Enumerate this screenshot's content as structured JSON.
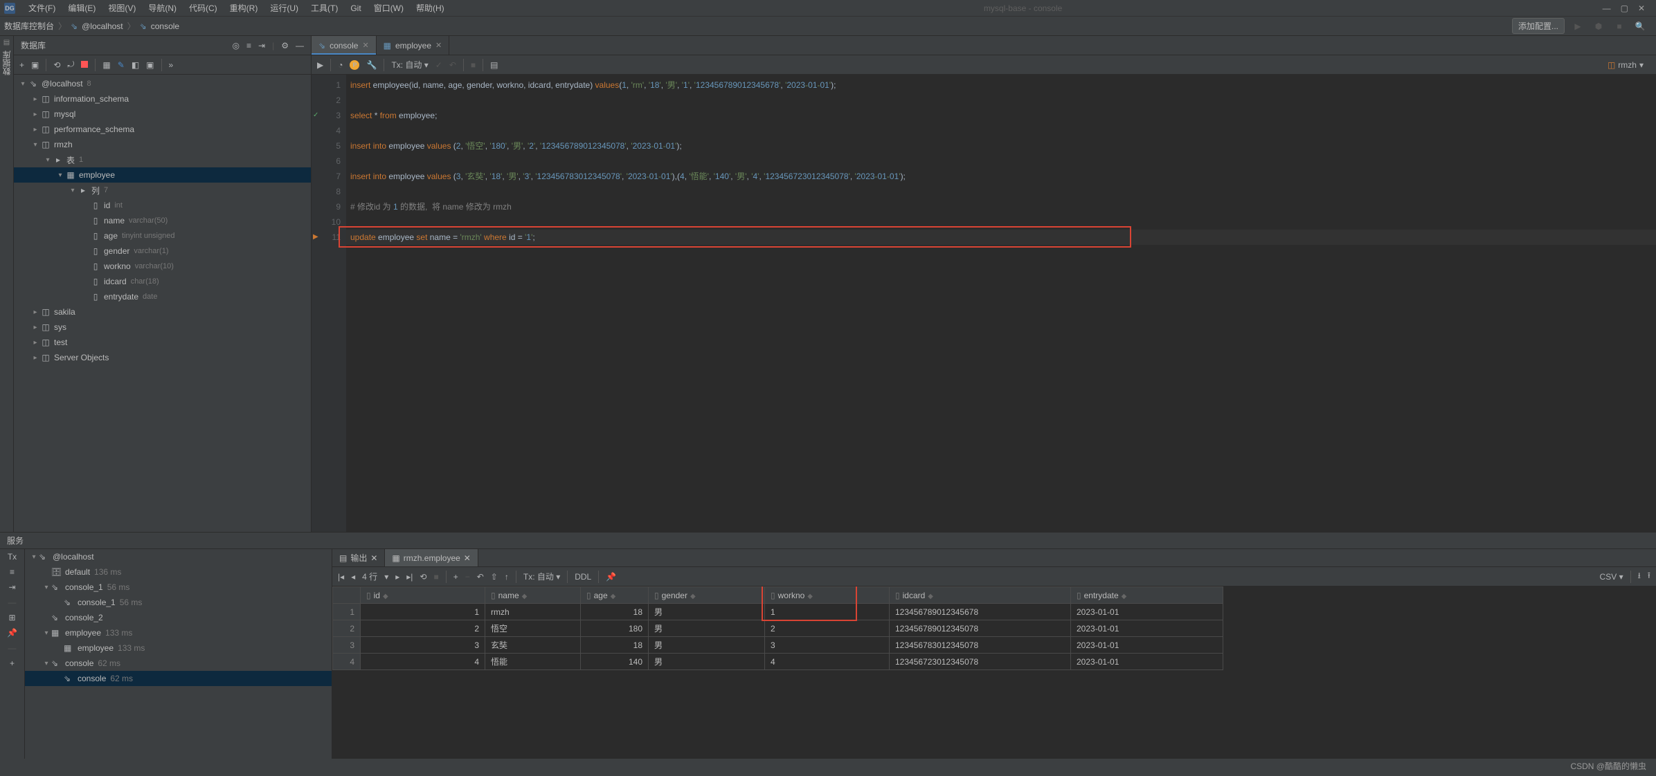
{
  "window": {
    "title": "mysql-base - console"
  },
  "menu": [
    "文件(F)",
    "编辑(E)",
    "视图(V)",
    "导航(N)",
    "代码(C)",
    "重构(R)",
    "运行(U)",
    "工具(T)",
    "Git",
    "窗口(W)",
    "帮助(H)"
  ],
  "breadcrumb": [
    "数据库控制台",
    "@localhost",
    "console"
  ],
  "nav_add_config": "添加配置...",
  "side_tab": "数据库",
  "db_panel_title": "数据库",
  "db_tree": {
    "root": {
      "label": "@localhost",
      "badge": "8"
    },
    "schemas": [
      {
        "label": "information_schema"
      },
      {
        "label": "mysql"
      },
      {
        "label": "performance_schema"
      },
      {
        "label": "rmzh",
        "expanded": true,
        "tables_label": "表",
        "tables_badge": "1",
        "table": {
          "label": "employee",
          "cols_label": "列",
          "cols_badge": "7",
          "columns": [
            {
              "name": "id",
              "type": "int"
            },
            {
              "name": "name",
              "type": "varchar(50)"
            },
            {
              "name": "age",
              "type": "tinyint unsigned"
            },
            {
              "name": "gender",
              "type": "varchar(1)"
            },
            {
              "name": "workno",
              "type": "varchar(10)"
            },
            {
              "name": "idcard",
              "type": "char(18)"
            },
            {
              "name": "entrydate",
              "type": "date"
            }
          ]
        }
      },
      {
        "label": "sakila"
      },
      {
        "label": "sys"
      },
      {
        "label": "test"
      },
      {
        "label": "Server Objects"
      }
    ]
  },
  "editor_tabs": [
    {
      "label": "console",
      "active": true,
      "icon": "console"
    },
    {
      "label": "employee",
      "active": false,
      "icon": "table"
    }
  ],
  "tx_label": "Tx: 自动",
  "schema_indicator": "rmzh",
  "code_lines": [
    "insert employee(id, name, age, gender, workno, idcard, entrydate) values(1, 'rm', '18', '男', '1', '123456789012345678', '2023-01-01');",
    "",
    "select * from employee;",
    "",
    "insert into employee values (2, '悟空', '180', '男', '2', '123456789012345078', '2023-01-01');",
    "",
    "insert into employee values (3, '玄奘', '18', '男', '3', '123456783012345078', '2023-01-01'),(4, '悟能', '140', '男', '4', '123456723012345078', '2023-01-01');",
    "",
    "# 修改id 为 1 的数据,  将 name 修改为 rmzh",
    "",
    "update employee set name = 'rmzh' where id = '1';"
  ],
  "services_title": "服务",
  "svc_tree": {
    "root": "@localhost",
    "items": [
      {
        "label": "default",
        "meta": "136 ms",
        "icon": "db"
      },
      {
        "label": "console_1",
        "meta": "56 ms",
        "icon": "console",
        "expanded": true,
        "children": [
          {
            "label": "console_1",
            "meta": "56 ms",
            "icon": "console"
          }
        ]
      },
      {
        "label": "console_2",
        "icon": "console"
      },
      {
        "label": "employee",
        "meta": "133 ms",
        "icon": "table",
        "expanded": true,
        "children": [
          {
            "label": "employee",
            "meta": "133 ms",
            "icon": "table"
          }
        ]
      },
      {
        "label": "console",
        "meta": "62 ms",
        "icon": "console",
        "expanded": true,
        "selected": true,
        "children": [
          {
            "label": "console",
            "meta": "62 ms",
            "icon": "console",
            "selected": true
          }
        ]
      }
    ]
  },
  "result_tabs": [
    {
      "label": "输出",
      "icon": "output"
    },
    {
      "label": "rmzh.employee",
      "icon": "table",
      "active": true
    }
  ],
  "result_toolbar": {
    "rows_label": "4 行",
    "tx": "Tx: 自动",
    "ddl": "DDL",
    "csv": "CSV"
  },
  "grid": {
    "columns": [
      "id",
      "name",
      "age",
      "gender",
      "workno",
      "idcard",
      "entrydate"
    ],
    "rows": [
      {
        "n": 1,
        "id": 1,
        "name": "rmzh",
        "age": 18,
        "gender": "男",
        "workno": "1",
        "idcard": "123456789012345678",
        "entrydate": "2023-01-01"
      },
      {
        "n": 2,
        "id": 2,
        "name": "悟空",
        "age": 180,
        "gender": "男",
        "workno": "2",
        "idcard": "123456789012345078",
        "entrydate": "2023-01-01"
      },
      {
        "n": 3,
        "id": 3,
        "name": "玄奘",
        "age": 18,
        "gender": "男",
        "workno": "3",
        "idcard": "123456783012345078",
        "entrydate": "2023-01-01"
      },
      {
        "n": 4,
        "id": 4,
        "name": "悟能",
        "age": 140,
        "gender": "男",
        "workno": "4",
        "idcard": "123456723012345078",
        "entrydate": "2023-01-01"
      }
    ]
  },
  "watermark": "CSDN @酷酷的懒虫"
}
